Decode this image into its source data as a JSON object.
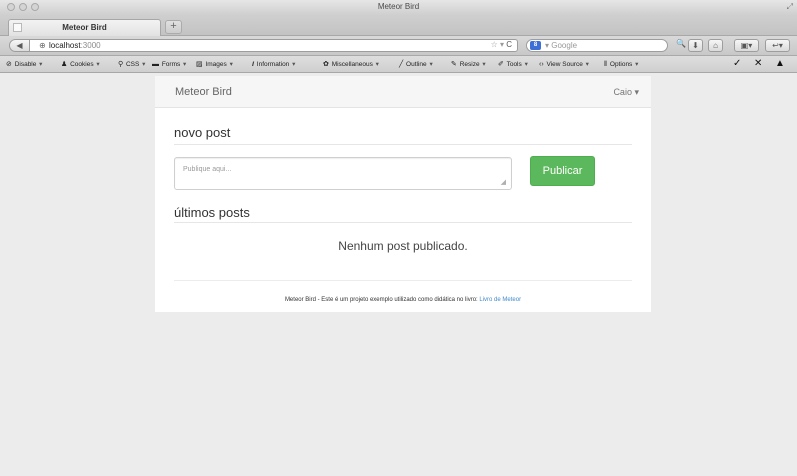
{
  "window": {
    "title": "Meteor Bird"
  },
  "tabs": [
    {
      "label": "Meteor Bird"
    }
  ],
  "newtab_label": "+",
  "navbar": {
    "url_host": "localhost",
    "url_port": ":3000",
    "search_engine_label": "8",
    "search_placeholder": "Google"
  },
  "devtoolbar": {
    "items": [
      "Disable",
      "Cookies",
      "CSS",
      "Forms",
      "Images",
      "Information",
      "Miscellaneous",
      "Outline",
      "Resize",
      "Tools",
      "View Source",
      "Options"
    ]
  },
  "app": {
    "brand": "Meteor Bird",
    "user_menu": "Caio",
    "new_post_title": "novo post",
    "post_placeholder": "Publique aqui...",
    "publish_label": "Publicar",
    "latest_title": "últimos posts",
    "empty_message": "Nenhum post publicado.",
    "footer_text": "Meteor Bird - Este é um projeto exemplo utilizado como didática no livro: ",
    "footer_link": "Livro de Meteor"
  },
  "colors": {
    "accent": "#5cb85c",
    "link": "#428bca"
  }
}
